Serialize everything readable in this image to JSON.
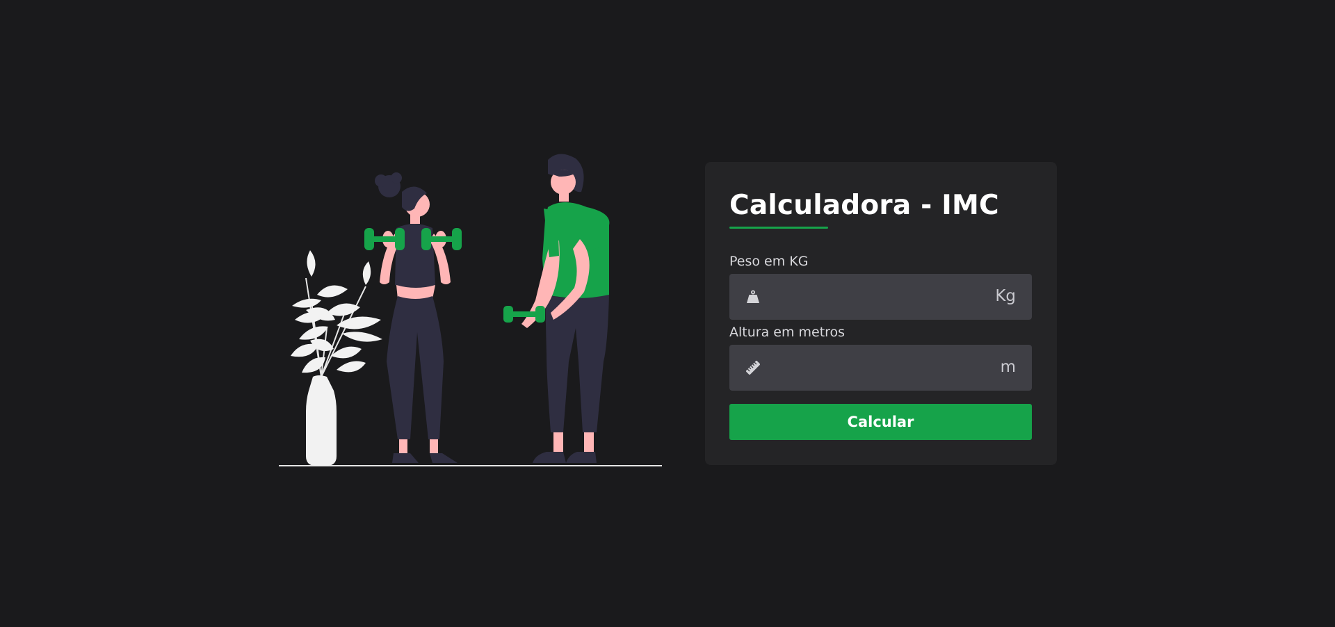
{
  "calculator": {
    "title": "Calculadora - IMC",
    "weight": {
      "label": "Peso em KG",
      "value": "",
      "placeholder": "",
      "unit": "Kg",
      "icon": "weight-icon"
    },
    "height": {
      "label": "Altura em metros",
      "value": "",
      "placeholder": "",
      "unit": "m",
      "icon": "ruler-icon"
    },
    "button_label": "Calcular"
  },
  "colors": {
    "background": "#1a1a1c",
    "card": "#242426",
    "input": "#3f3f45",
    "accent": "#16a34a"
  }
}
